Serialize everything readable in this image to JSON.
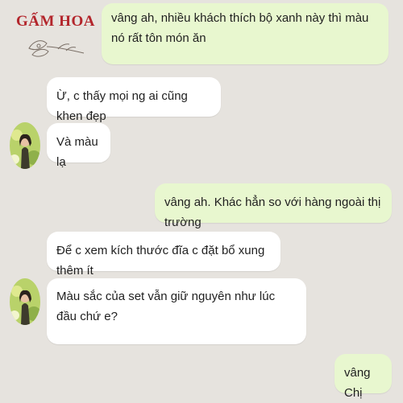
{
  "brand": {
    "logo_text": "GẤM HOA"
  },
  "messages": [
    {
      "side": "out",
      "text": "vâng ah, nhiều khách thích bộ xanh này thì màu nó rất tôn món ăn"
    },
    {
      "side": "in",
      "text": "Ừ, c thấy mọi ng ai cũng khen đẹp"
    },
    {
      "side": "in",
      "text": "Và màu lạ"
    },
    {
      "side": "out",
      "text": "vâng ah. Khác hẳn so với hàng ngoài thị trường"
    },
    {
      "side": "in",
      "text": "Để c xem kích thước đĩa c đặt bổ xung thêm ít"
    },
    {
      "side": "in",
      "text": "Màu sắc của set vẫn giữ nguyên như lúc đầu chứ e?"
    },
    {
      "side": "out",
      "text": "vâng Chị"
    }
  ],
  "colors": {
    "background": "#e6e3de",
    "outgoing_bubble": "#e8f7cf",
    "incoming_bubble": "#ffffff",
    "brand_red": "#b3262c"
  }
}
